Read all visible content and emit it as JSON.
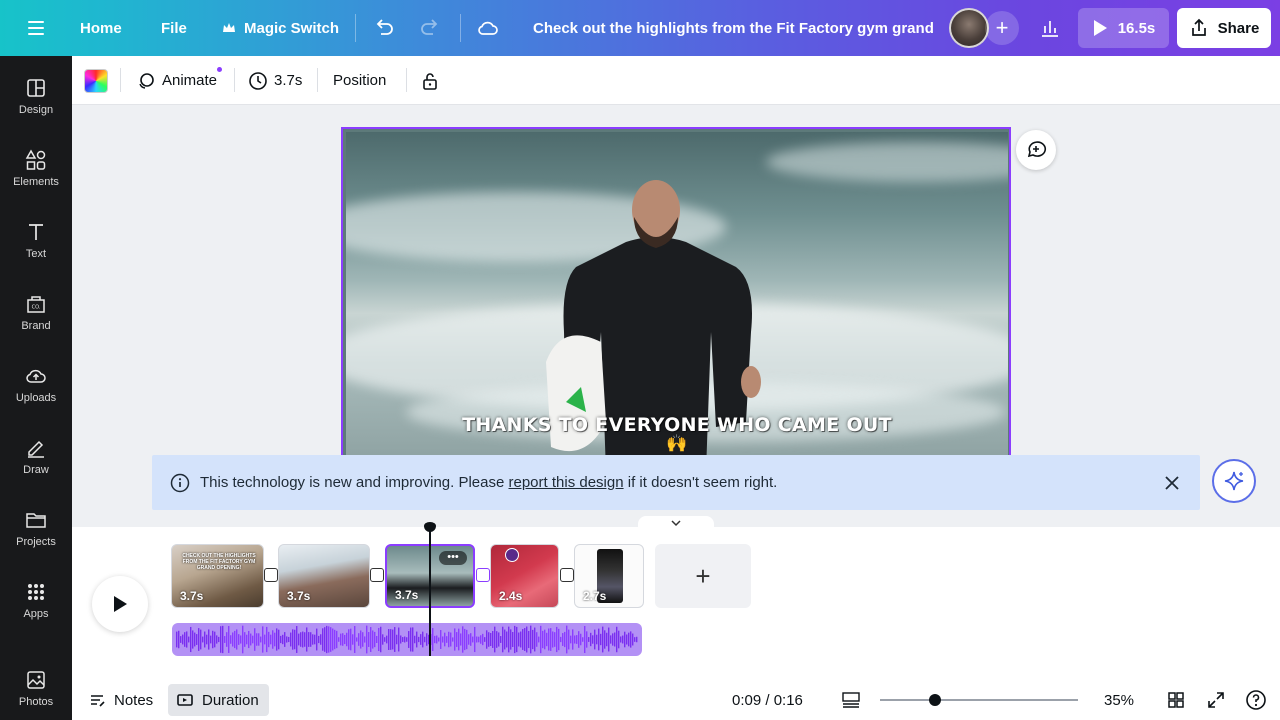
{
  "topbar": {
    "home": "Home",
    "file": "File",
    "magic_switch": "Magic Switch",
    "title": "Check out the highlights from the Fit Factory gym grand ...",
    "play_duration": "16.5s",
    "share": "Share"
  },
  "sidebar": {
    "items": [
      {
        "label": "Design",
        "icon": "design-icon"
      },
      {
        "label": "Elements",
        "icon": "elements-icon"
      },
      {
        "label": "Text",
        "icon": "text-icon"
      },
      {
        "label": "Brand",
        "icon": "brand-icon"
      },
      {
        "label": "Uploads",
        "icon": "uploads-icon"
      },
      {
        "label": "Draw",
        "icon": "draw-icon"
      },
      {
        "label": "Projects",
        "icon": "projects-icon"
      },
      {
        "label": "Apps",
        "icon": "apps-icon"
      },
      {
        "label": "Photos",
        "icon": "photos-icon"
      }
    ]
  },
  "toolbar": {
    "animate": "Animate",
    "duration": "3.7s",
    "position": "Position"
  },
  "canvas": {
    "caption": "THANKS TO EVERYONE WHO CAME OUT",
    "caption_emoji": "🙌"
  },
  "banner": {
    "text_before": "This technology is new and improving. Please ",
    "link": "report this design",
    "text_after": " if it doesn't seem right."
  },
  "timeline": {
    "clips": [
      {
        "duration": "3.7s"
      },
      {
        "duration": "3.7s"
      },
      {
        "duration": "3.7s"
      },
      {
        "duration": "2.4s"
      },
      {
        "duration": "2.7s"
      }
    ],
    "clip1_overlay": "CHECK OUT THE HIGHLIGHTS FROM THE FIT FACTORY GYM GRAND OPENING!"
  },
  "footer": {
    "notes": "Notes",
    "duration": "Duration",
    "time": "0:09 / 0:16",
    "zoom": "35%",
    "zoom_level": 0.28
  },
  "colors": {
    "accent": "#8b3dff",
    "sidebar_bg": "#18191b",
    "banner_bg": "#d4e3fb"
  }
}
